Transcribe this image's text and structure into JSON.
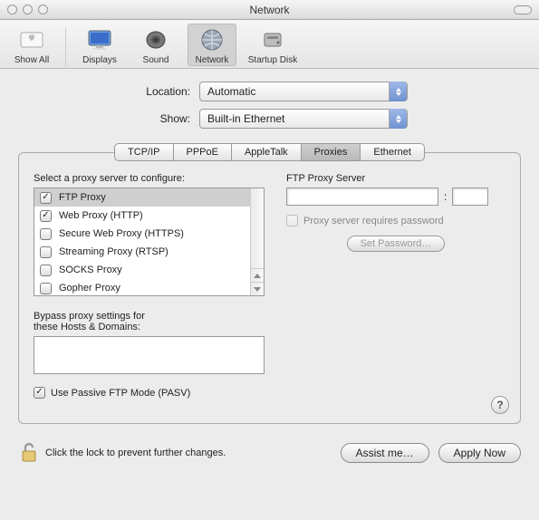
{
  "window": {
    "title": "Network"
  },
  "toolbar": {
    "items": [
      {
        "key": "show-all",
        "label": "Show All"
      },
      {
        "key": "displays",
        "label": "Displays"
      },
      {
        "key": "sound",
        "label": "Sound"
      },
      {
        "key": "network",
        "label": "Network"
      },
      {
        "key": "startup-disk",
        "label": "Startup Disk"
      }
    ],
    "selected": "network"
  },
  "selectors": {
    "location_label": "Location:",
    "location_value": "Automatic",
    "show_label": "Show:",
    "show_value": "Built-in Ethernet"
  },
  "tabs": {
    "items": [
      "TCP/IP",
      "PPPoE",
      "AppleTalk",
      "Proxies",
      "Ethernet"
    ],
    "active": "Proxies"
  },
  "proxies": {
    "select_label": "Select a proxy server to configure:",
    "list": [
      {
        "label": "FTP Proxy",
        "checked": true,
        "selected": true
      },
      {
        "label": "Web Proxy (HTTP)",
        "checked": true,
        "selected": false
      },
      {
        "label": "Secure Web Proxy (HTTPS)",
        "checked": false,
        "selected": false
      },
      {
        "label": "Streaming Proxy (RTSP)",
        "checked": false,
        "selected": false
      },
      {
        "label": "SOCKS Proxy",
        "checked": false,
        "selected": false
      },
      {
        "label": "Gopher Proxy",
        "checked": false,
        "selected": false
      }
    ],
    "server_label": "FTP Proxy Server",
    "server_host": "",
    "server_port_separator": ":",
    "server_port": "",
    "requires_password_label": "Proxy server requires password",
    "requires_password_checked": false,
    "set_password_label": "Set Password…",
    "bypass_label_line1": "Bypass proxy settings for",
    "bypass_label_line2": "these Hosts & Domains:",
    "bypass_value": "",
    "passive_ftp_label": "Use Passive FTP Mode (PASV)",
    "passive_ftp_checked": true,
    "help_label": "?"
  },
  "footer": {
    "lock_text": "Click the lock to prevent further changes.",
    "assist_label": "Assist me…",
    "apply_label": "Apply Now"
  }
}
